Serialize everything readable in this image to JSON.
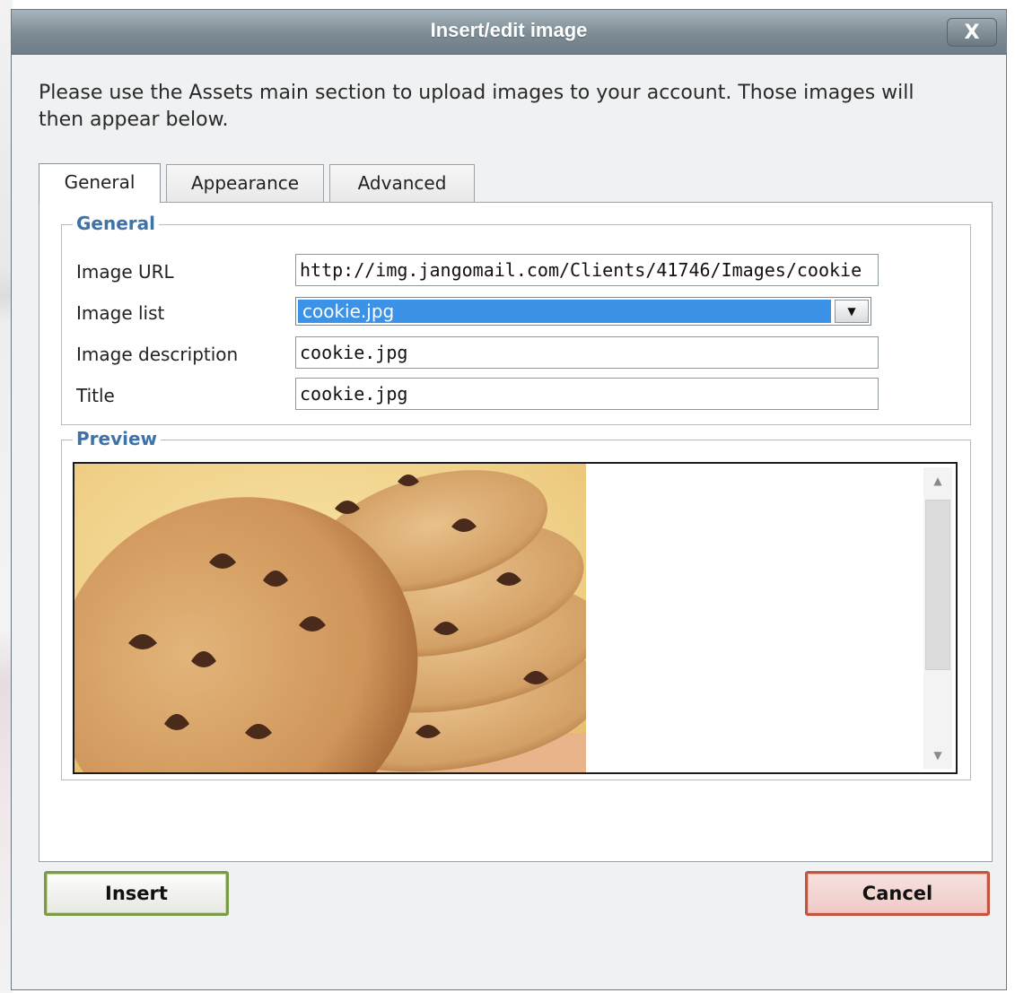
{
  "window": {
    "title": "Insert/edit image",
    "close_label": "X"
  },
  "intro_text": "Please use the Assets main section to upload images to your account. Those images will then appear below.",
  "tabs": [
    {
      "label": "General",
      "active": true
    },
    {
      "label": "Appearance",
      "active": false
    },
    {
      "label": "Advanced",
      "active": false
    }
  ],
  "general": {
    "legend": "General",
    "image_url_label": "Image URL",
    "image_url_value": "http://img.jangomail.com/Clients/41746/Images/cookie",
    "image_list_label": "Image list",
    "image_list_value": "cookie.jpg",
    "image_description_label": "Image description",
    "image_description_value": "cookie.jpg",
    "title_label": "Title",
    "title_value": "cookie.jpg"
  },
  "preview": {
    "legend": "Preview"
  },
  "buttons": {
    "insert": "Insert",
    "cancel": "Cancel"
  },
  "colors": {
    "titlebar": "#7c8b94",
    "legend_text": "#3d73a8",
    "selected_option": "#3c92e6",
    "insert_border": "#7a9a46",
    "cancel_border": "#c4543e"
  }
}
